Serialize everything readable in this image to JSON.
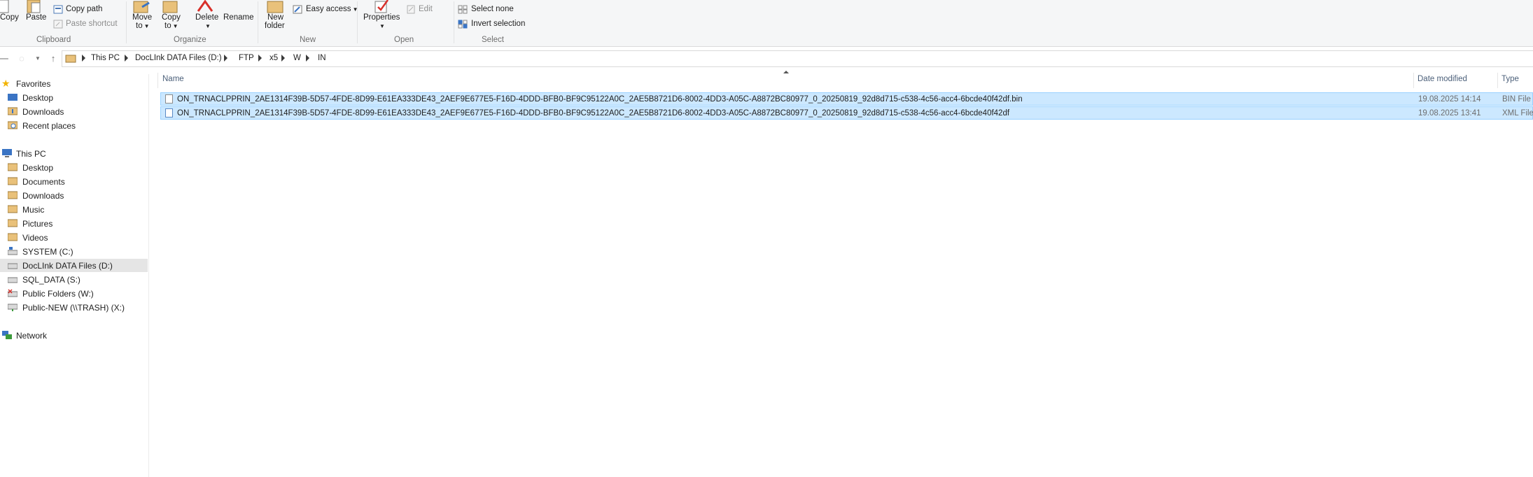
{
  "ribbon": {
    "clipboard": {
      "label": "Clipboard",
      "copy": "Copy",
      "paste": "Paste",
      "copy_path": "Copy path",
      "paste_shortcut": "Paste shortcut"
    },
    "organize": {
      "label": "Organize",
      "move_to_1": "Move",
      "move_to_2": "to",
      "copy_to_1": "Copy",
      "copy_to_2": "to",
      "delete": "Delete",
      "rename": "Rename"
    },
    "new": {
      "label": "New",
      "new_folder_1": "New",
      "new_folder_2": "folder",
      "easy_access": "Easy access"
    },
    "open": {
      "label": "Open",
      "properties": "Properties",
      "edit": "Edit"
    },
    "select": {
      "label": "Select",
      "select_none": "Select none",
      "invert_selection": "Invert selection"
    }
  },
  "address": {
    "crumbs": [
      "This PC",
      "DocLInk DATA Files (D:)",
      "FTP",
      "x5",
      "W",
      "IN"
    ]
  },
  "nav": {
    "favorites": "Favorites",
    "fav_items": [
      "Desktop",
      "Downloads",
      "Recent places"
    ],
    "this_pc": "This PC",
    "pc_items": [
      "Desktop",
      "Documents",
      "Downloads",
      "Music",
      "Pictures",
      "Videos",
      "SYSTEM (C:)",
      "DocLInk DATA Files (D:)",
      "SQL_DATA (S:)",
      "Public Folders (W:)",
      "Public-NEW (\\\\TRASH) (X:)"
    ],
    "network": "Network"
  },
  "columns": {
    "name": "Name",
    "date_modified": "Date modified",
    "type": "Type"
  },
  "files": [
    {
      "name": "ON_TRNACLPPRIN_2AE1314F39B-5D57-4FDE-8D99-E61EA333DE43_2AEF9E677E5-F16D-4DDD-BFB0-BF9C95122A0C_2AE5B8721D6-8002-4DD3-A05C-A8872BC80977_0_20250819_92d8d715-c538-4c56-acc4-6bcde40f42df.bin",
      "date": "19.08.2025 14:14",
      "type": "BIN File"
    },
    {
      "name": "ON_TRNACLPPRIN_2AE1314F39B-5D57-4FDE-8D99-E61EA333DE43_2AEF9E677E5-F16D-4DDD-BFB0-BF9C95122A0C_2AE5B8721D6-8002-4DD3-A05C-A8872BC80977_0_20250819_92d8d715-c538-4c56-acc4-6bcde40f42df",
      "date": "19.08.2025 13:41",
      "type": "XML File"
    }
  ],
  "colors": {
    "selection_bg": "#cce8ff",
    "selection_border": "#99d1ff",
    "nav_selected": "#e5e5e5",
    "header_text": "#4c607a"
  }
}
